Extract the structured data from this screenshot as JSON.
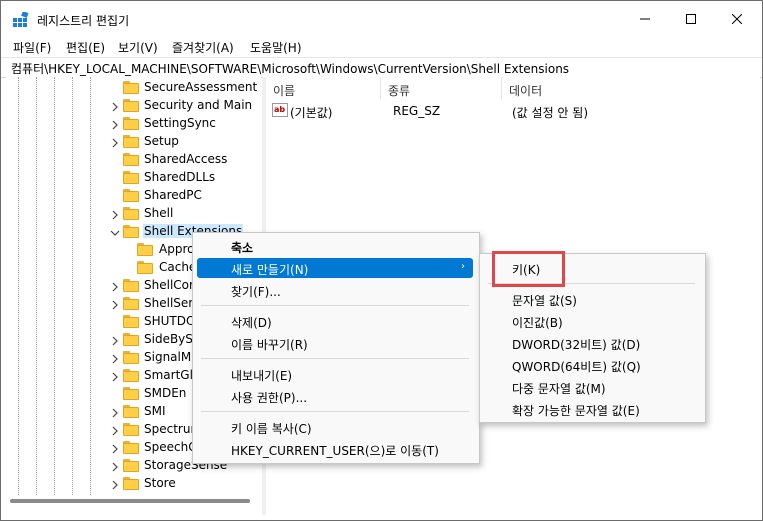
{
  "window": {
    "title": "레지스트리 편집기",
    "buttons": {
      "minimize": "minimize-icon",
      "maximize": "maximize-icon",
      "close": "close-icon"
    }
  },
  "menubar": [
    "파일(F)",
    "편집(E)",
    "보기(V)",
    "즐겨찾기(A)",
    "도움말(H)"
  ],
  "address": "컴퓨터\\HKEY_LOCAL_MACHINE\\SOFTWARE\\Microsoft\\Windows\\CurrentVersion\\Shell Extensions",
  "tree": {
    "items": [
      {
        "label": "SecureAssessment",
        "expander": "none"
      },
      {
        "label": "Security and Main",
        "expander": "collapsed"
      },
      {
        "label": "SettingSync",
        "expander": "collapsed"
      },
      {
        "label": "Setup",
        "expander": "collapsed"
      },
      {
        "label": "SharedAccess",
        "expander": "none"
      },
      {
        "label": "SharedDLLs",
        "expander": "none"
      },
      {
        "label": "SharedPC",
        "expander": "none"
      },
      {
        "label": "Shell",
        "expander": "collapsed"
      },
      {
        "label": "Shell Extensions",
        "expander": "expanded",
        "selected": true
      },
      {
        "label": "Appro",
        "expander": "none",
        "child": true
      },
      {
        "label": "Cache",
        "expander": "none",
        "child": true
      },
      {
        "label": "ShellCom",
        "expander": "collapsed"
      },
      {
        "label": "ShellServ",
        "expander": "collapsed"
      },
      {
        "label": "SHUTDO",
        "expander": "none"
      },
      {
        "label": "SideBySi",
        "expander": "collapsed"
      },
      {
        "label": "SignalMa",
        "expander": "collapsed"
      },
      {
        "label": "SmartGla",
        "expander": "collapsed"
      },
      {
        "label": "SMDEn",
        "expander": "none"
      },
      {
        "label": "SMI",
        "expander": "collapsed"
      },
      {
        "label": "Spectrum",
        "expander": "collapsed"
      },
      {
        "label": "SpeechG",
        "expander": "collapsed"
      },
      {
        "label": "StorageSense",
        "expander": "collapsed"
      },
      {
        "label": "Store",
        "expander": "collapsed"
      }
    ]
  },
  "list": {
    "columns": [
      "이름",
      "종류",
      "데이터"
    ],
    "rows": [
      {
        "name": "(기본값)",
        "type": "REG_SZ",
        "data": "(값 설정 안 됨)",
        "icon": "ab-string-icon"
      }
    ]
  },
  "context_menu": {
    "items": [
      "축소",
      "새로 만들기(N)",
      "찾기(F)...",
      "삭제(D)",
      "이름 바꾸기(R)",
      "내보내기(E)",
      "사용 권한(P)...",
      "키 이름 복사(C)",
      "HKEY_CURRENT_USER(으)로 이동(T)"
    ],
    "highlighted": "새로 만들기(N)"
  },
  "submenu": {
    "items": [
      "키(K)",
      "문자열 값(S)",
      "이진값(B)",
      "DWORD(32비트) 값(D)",
      "QWORD(64비트) 값(Q)",
      "다중 문자열 값(M)",
      "확장 가능한 문자열 값(E)"
    ],
    "highlighted_box": "키(K)"
  },
  "colors": {
    "accent": "#0078d4",
    "selection": "#cce8ff",
    "annotation": "#e0474a",
    "folder": "#ffcf48"
  }
}
